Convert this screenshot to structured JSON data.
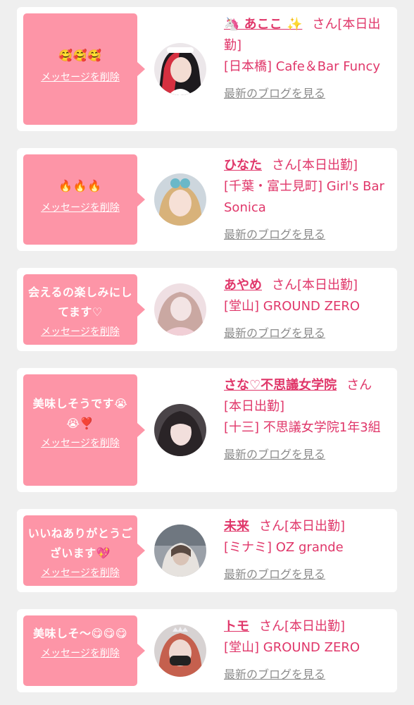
{
  "delete_label": "メッセージを削除",
  "blog_label": "最新のブログを見る",
  "entries": [
    {
      "message": "🥰🥰🥰",
      "name": "🦄 あここ ✨",
      "san": "さん[本日出勤]",
      "shop": "[日本橋] Cafe＆Bar Funcy"
    },
    {
      "message": "🔥🔥🔥",
      "name": "ひなた",
      "san": "さん[本日出勤]",
      "shop": "[千葉・富士見町] Girl's Bar Sonica"
    },
    {
      "message": "会えるの楽しみにしてます♡",
      "name": "あやめ",
      "san": "さん[本日出勤]",
      "shop": "[堂山] GROUND ZERO"
    },
    {
      "message": "美味しそうです😭😭❣️",
      "name": "さな♡不思議女学院",
      "san": "さん[本日出勤]",
      "shop": "[十三] 不思議女学院1年3組"
    },
    {
      "message": "いいねありがとうございます💖",
      "name": "未来",
      "san": "さん[本日出勤]",
      "shop": "[ミナミ] OZ grande"
    },
    {
      "message": "美味しそ〜😋😋😋",
      "name": "トモ",
      "san": "さん[本日出勤]",
      "shop": "[堂山] GROUND ZERO"
    }
  ],
  "colors": {
    "bubble": "#fd95a7",
    "name": "#e0376a",
    "link": "#8c8c8c",
    "background": "#efefef"
  }
}
